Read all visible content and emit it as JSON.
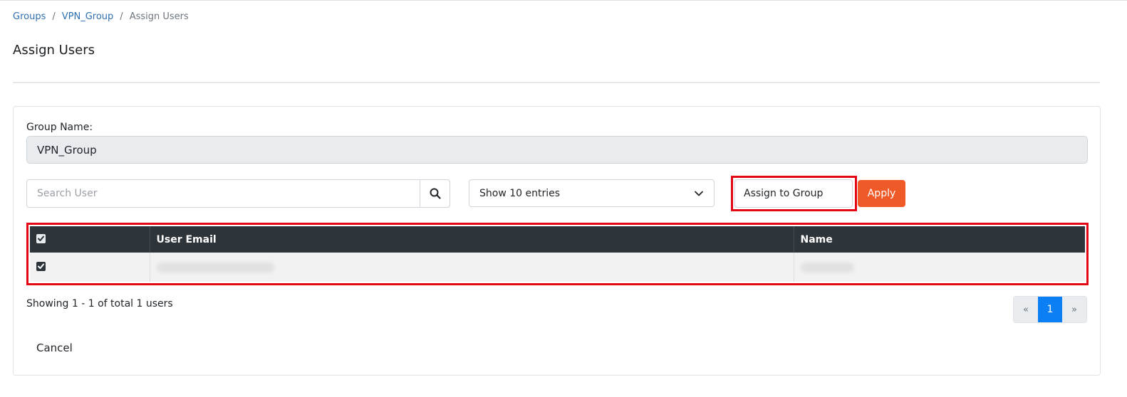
{
  "breadcrumb": {
    "items": [
      {
        "label": "Groups"
      },
      {
        "label": "VPN_Group"
      }
    ],
    "separator": "/",
    "current": "Assign Users"
  },
  "page": {
    "title": "Assign Users"
  },
  "form": {
    "group_name_label": "Group Name:",
    "group_name_value": "VPN_Group",
    "search_placeholder": "Search User",
    "entries_select_value": "Show 10 entries",
    "action_select_value": "Assign to Group",
    "apply_label": "Apply"
  },
  "table": {
    "columns": [
      "User Email",
      "Name"
    ],
    "rows": [
      {
        "checked": true,
        "email": "",
        "name": ""
      }
    ]
  },
  "footer": {
    "showing_text": "Showing 1 - 1 of total 1 users",
    "pagination": {
      "prev": "«",
      "current": "1",
      "next": "»"
    },
    "cancel_label": "Cancel"
  },
  "colors": {
    "link": "#2f6fb0",
    "apply_button": "#f05a28",
    "table_header": "#2d343a",
    "highlight": "#e30613",
    "page_active": "#0d7ff5"
  },
  "icons": {
    "search": "search-icon",
    "dropdown": "chevron-down-icon",
    "checkbox": "checkbox-checked-icon"
  }
}
